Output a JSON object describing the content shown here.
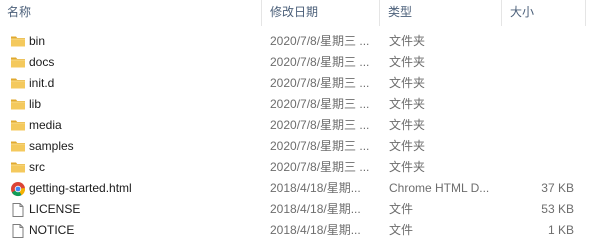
{
  "columns": {
    "name": "名称",
    "date": "修改日期",
    "type": "类型",
    "size": "大小"
  },
  "sort_indicator": "^",
  "files": [
    {
      "name": "bin",
      "date": "2020/7/8/星期三 ...",
      "type": "文件夹",
      "size": "",
      "icon": "folder-icon"
    },
    {
      "name": "docs",
      "date": "2020/7/8/星期三 ...",
      "type": "文件夹",
      "size": "",
      "icon": "folder-icon"
    },
    {
      "name": "init.d",
      "date": "2020/7/8/星期三 ...",
      "type": "文件夹",
      "size": "",
      "icon": "folder-icon"
    },
    {
      "name": "lib",
      "date": "2020/7/8/星期三 ...",
      "type": "文件夹",
      "size": "",
      "icon": "folder-icon"
    },
    {
      "name": "media",
      "date": "2020/7/8/星期三 ...",
      "type": "文件夹",
      "size": "",
      "icon": "folder-icon"
    },
    {
      "name": "samples",
      "date": "2020/7/8/星期三 ...",
      "type": "文件夹",
      "size": "",
      "icon": "folder-icon"
    },
    {
      "name": "src",
      "date": "2020/7/8/星期三 ...",
      "type": "文件夹",
      "size": "",
      "icon": "folder-icon"
    },
    {
      "name": "getting-started.html",
      "date": "2018/4/18/星期...",
      "type": "Chrome HTML D...",
      "size": "37 KB",
      "icon": "chrome-html-icon"
    },
    {
      "name": "LICENSE",
      "date": "2018/4/18/星期...",
      "type": "文件",
      "size": "53 KB",
      "icon": "file-icon"
    },
    {
      "name": "NOTICE",
      "date": "2018/4/18/星期...",
      "type": "文件",
      "size": "1 KB",
      "icon": "file-icon"
    }
  ],
  "colors": {
    "header_text": "#4c607a",
    "folder": "#f4c95d",
    "folder_dark": "#e0a92f"
  }
}
